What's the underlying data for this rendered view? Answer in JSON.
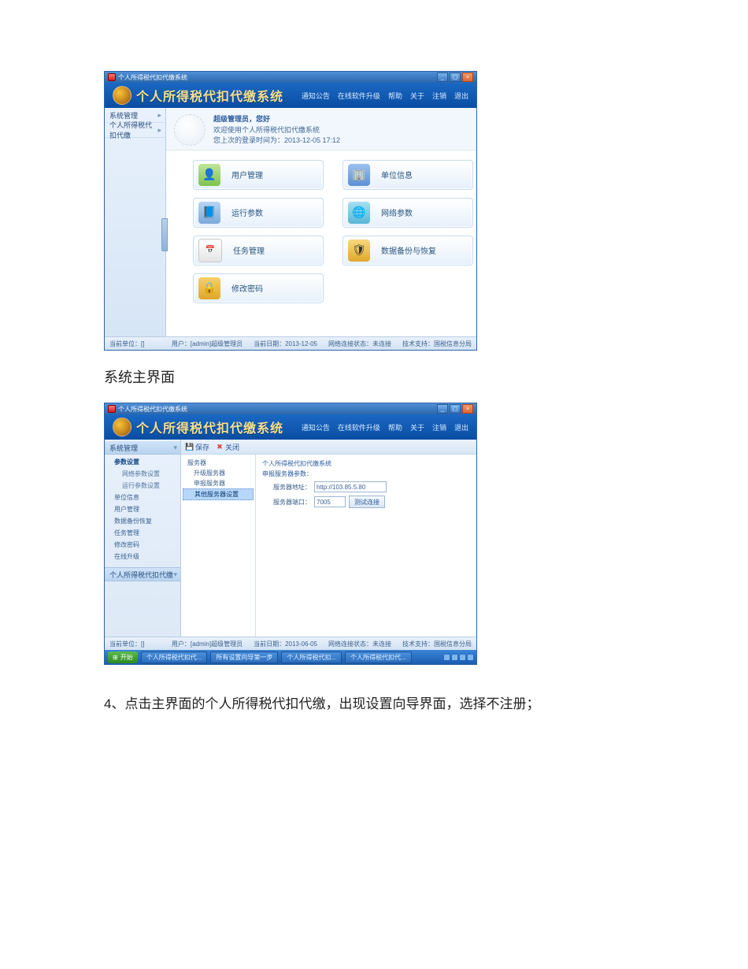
{
  "captions": {
    "main_ui": "系统主界面",
    "step4": "4、点击主界面的个人所得税代扣代缴，出现设置向导界面，选择不注册；"
  },
  "win1": {
    "title": "个人所得税代扣代缴系统",
    "banner_title": "个人所得税代扣代缴系统",
    "banner_links": [
      "通知公告",
      "在线软件升级",
      "帮助",
      "关于",
      "注销",
      "退出"
    ],
    "sidebar": [
      {
        "label": "系统管理",
        "arrow": "▸"
      },
      {
        "label": "个人所得税代扣代缴",
        "arrow": "▸"
      }
    ],
    "welcome": {
      "row1": "超级管理员，您好",
      "row2": "欢迎使用个人所得税代扣代缴系统",
      "row3": "您上次的登录时间为：2013-12-05 17:12"
    },
    "tiles": [
      {
        "label": "用户管理",
        "icon": "👤"
      },
      {
        "label": "单位信息",
        "icon": "🏢"
      },
      {
        "label": "运行参数",
        "icon": "📘"
      },
      {
        "label": "网络参数",
        "icon": "🌐"
      },
      {
        "label": "任务管理",
        "icon": "📅"
      },
      {
        "label": "数据备份与恢复",
        "icon": "🛡"
      },
      {
        "label": "修改密码",
        "icon": "🔒"
      }
    ],
    "status": {
      "unit": "当前单位：[]",
      "user": "用户：[admin]超级管理员",
      "date": "当前日期：2013-12-05",
      "net": "网络连接状态：未连接",
      "support": "技术支持：国税信息分局"
    }
  },
  "win2": {
    "title": "个人所得税代扣代缴系统",
    "banner_title": "个人所得税代扣代缴系统",
    "banner_links": [
      "通知公告",
      "在线软件升级",
      "帮助",
      "关于",
      "注销",
      "退出"
    ],
    "side_head": "系统管理",
    "side_tree": [
      {
        "label": "参数设置",
        "sub": false,
        "sel": true
      },
      {
        "label": "网络参数设置",
        "sub": true,
        "sel": false
      },
      {
        "label": "运行参数设置",
        "sub": true,
        "sel": false
      },
      {
        "label": "单位信息",
        "sub": false,
        "sel": false
      },
      {
        "label": "用户管理",
        "sub": false,
        "sel": false
      },
      {
        "label": "数据备份恢复",
        "sub": false,
        "sel": false
      },
      {
        "label": "任务管理",
        "sub": false,
        "sel": false
      },
      {
        "label": "修改密码",
        "sub": false,
        "sel": false
      },
      {
        "label": "在线升级",
        "sub": false,
        "sel": false
      }
    ],
    "side_section": "个人所得税代扣代缴",
    "toolbar": [
      {
        "label": "保存",
        "iconColor": "#2c7"
      },
      {
        "label": "关闭",
        "iconColor": "#d44"
      }
    ],
    "tree2": [
      {
        "label": "服务器",
        "sub": false,
        "sel": false
      },
      {
        "label": "升级服务器",
        "sub": true,
        "sel": false
      },
      {
        "label": "申报服务器",
        "sub": true,
        "sel": false
      },
      {
        "label": "其他服务器设置",
        "sub": true,
        "sel": true
      }
    ],
    "form": {
      "title1": "个人所得税代扣代缴系统",
      "title2": "申报服务器参数：",
      "row1_label": "服务器地址：",
      "row1_value": "http://103.85.5.80",
      "row2_label": "服务器端口：",
      "row2_value": "7005",
      "btn": "测试连接"
    },
    "status": {
      "unit": "当前单位：[]",
      "user": "用户：[admin]超级管理员",
      "date": "当前日期：2013-06-05",
      "net": "网络连接状态：未连接",
      "support": "技术支持：国税信息分局"
    },
    "taskbar": {
      "start": "开始",
      "items": [
        "个人所得税代扣代...",
        "所有设置向导第一步",
        "个人所得税代扣...",
        "个人所得税代扣代..."
      ]
    }
  }
}
